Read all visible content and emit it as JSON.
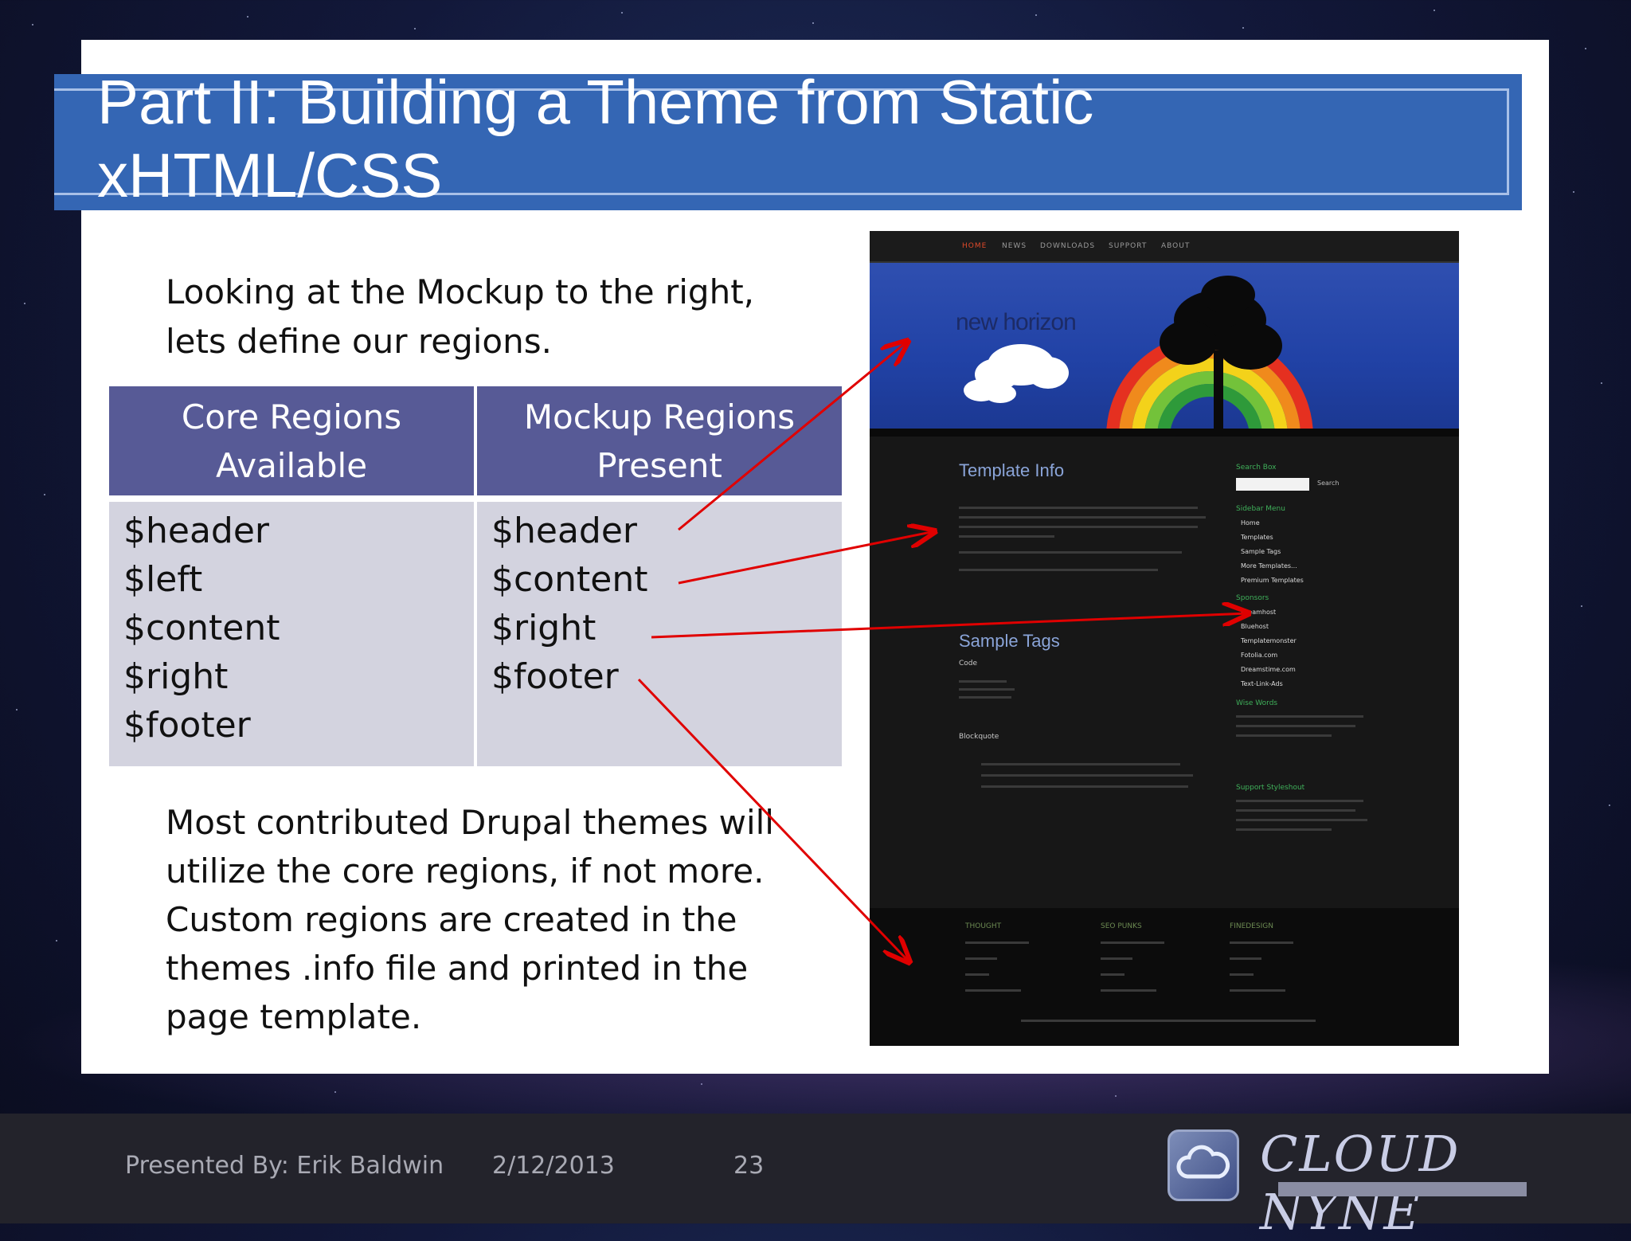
{
  "slide": {
    "title": "Part II: Building a Theme from Static xHTML/CSS",
    "intro": "Looking at the Mockup to the right, lets define our regions.",
    "table": {
      "headers": [
        "Core Regions Available",
        "Mockup Regions Present"
      ],
      "core_regions": [
        "$header",
        "$left",
        "$content",
        "$right",
        "$footer"
      ],
      "mockup_regions": [
        "$header",
        "$content",
        "$right",
        "$footer"
      ]
    },
    "body": "Most contributed Drupal themes will utilize the core regions, if not more. Custom regions are created in the themes .info file and printed in the page template."
  },
  "mockup": {
    "nav": [
      "HOME",
      "NEWS",
      "DOWNLOADS",
      "SUPPORT",
      "ABOUT"
    ],
    "logo": "new horizon",
    "content_headings": [
      "Template Info",
      "Sample Tags"
    ],
    "code_label": "Code",
    "blockquote_label": "Blockquote",
    "sidebar_headings": [
      "Search Box",
      "Sidebar Menu",
      "Sponsors",
      "Wise Words",
      "Support Styleshout"
    ],
    "sidebar_menu": [
      "Home",
      "Templates",
      "Sample Tags",
      "More Templates...",
      "Premium Templates"
    ],
    "sponsors": [
      "Dreamhost",
      "Bluehost",
      "Templatemonster",
      "Fotolia.com",
      "Dreamstime.com",
      "Text-Link-Ads"
    ],
    "search_button": "Search",
    "footer_headings": [
      "THOUGHT",
      "SEO PUNKS",
      "FINEDESIGN"
    ]
  },
  "footer": {
    "presenter": "Presented By: Erik Baldwin",
    "date": "2/12/2013",
    "page": "23",
    "brand": "CLOUD NYNE"
  },
  "colors": {
    "title_band": "#3466b4",
    "table_header": "#575a96",
    "table_body": "#d3d3df",
    "arrow": "#e00000"
  }
}
